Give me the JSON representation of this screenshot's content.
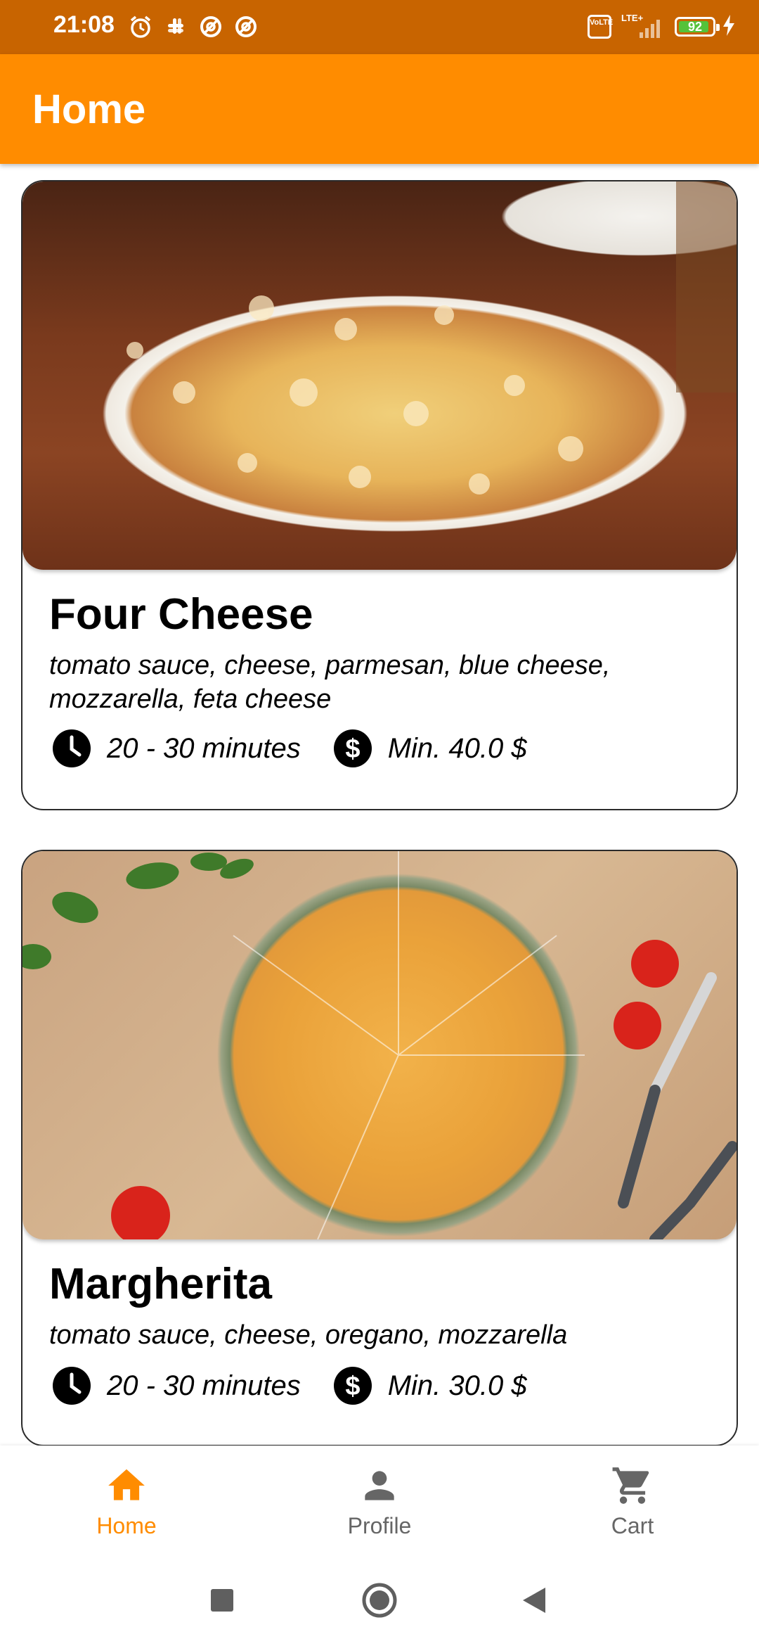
{
  "status_bar": {
    "time": "21:08",
    "battery": "92",
    "network_badge": "VoLTE",
    "network_label": "LTE+",
    "icons": [
      "alarm-icon",
      "slack-icon",
      "at-sign-icon",
      "at-sign-icon",
      "volte-icon",
      "signal-icon",
      "battery-icon",
      "charging-icon"
    ]
  },
  "appbar": {
    "title": "Home"
  },
  "cards": [
    {
      "title": "Four Cheese",
      "description": "tomato sauce, cheese, parmesan, blue cheese, mozzarella, feta cheese",
      "time": "20 - 30 minutes",
      "min_price": "Min. 40.0 $"
    },
    {
      "title": "Margherita",
      "description": "tomato sauce, cheese, oregano, mozzarella",
      "time": "20 - 30 minutes",
      "min_price": "Min. 30.0 $"
    }
  ],
  "bottom_nav": {
    "items": [
      {
        "label": "Home",
        "icon": "home-icon",
        "active": true
      },
      {
        "label": "Profile",
        "icon": "person-icon",
        "active": false
      },
      {
        "label": "Cart",
        "icon": "cart-icon",
        "active": false
      }
    ],
    "active_color": "#ff8c00",
    "inactive_color": "#666666"
  },
  "colors": {
    "status_bar": "#c86400",
    "appbar": "#ff8c00"
  }
}
